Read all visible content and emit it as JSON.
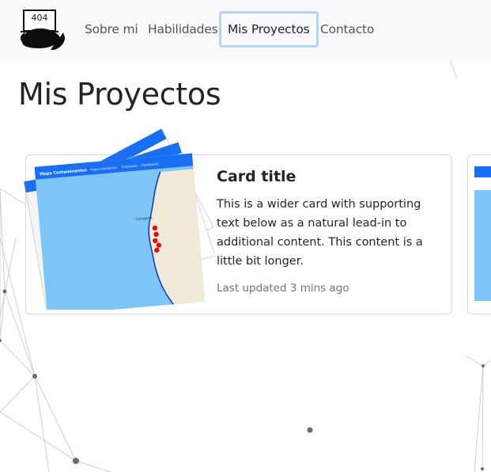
{
  "navbar": {
    "logo_text": "404",
    "links": [
      {
        "label": "Sobre mi"
      },
      {
        "label": "Habilidades"
      },
      {
        "label": "Mis Proyectos",
        "active": true
      },
      {
        "label": "Contacto"
      }
    ]
  },
  "page": {
    "title": "Mis Proyectos"
  },
  "card": {
    "title": "Card title",
    "text": "This is a wider card with supporting text below as a natural lead-in to additional content. This content is a little bit longer.",
    "updated": "Last updated 3 mins ago",
    "image": {
      "app_name": "Mapa Contaminantes",
      "menu": [
        "Mapa Interactivo",
        "Empresas",
        "Dashboard"
      ],
      "map_label": "Cartagena",
      "colors": {
        "header": "#1a6ef2",
        "sea": "#7dc4f7",
        "land": "#f1ead8",
        "pins": "#e01010"
      }
    }
  },
  "colors": {
    "navbar_bg": "#f8f9fa",
    "active_border": "#b7d2f6",
    "text": "#212529",
    "muted": "#6c757d"
  }
}
